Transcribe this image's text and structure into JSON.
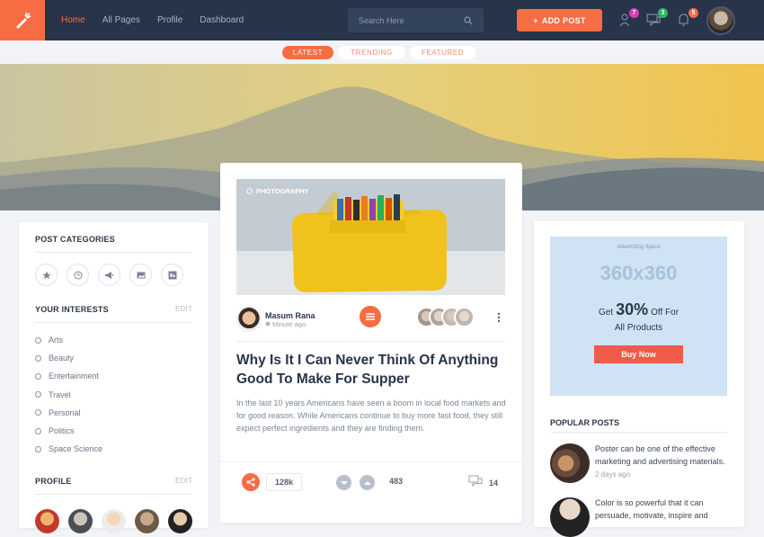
{
  "nav": {
    "items": [
      {
        "label": "Home",
        "active": true
      },
      {
        "label": "All Pages",
        "active": false
      },
      {
        "label": "Profile",
        "active": false
      },
      {
        "label": "Dashboard",
        "active": false
      }
    ],
    "search_placeholder": "Search Here",
    "add_post_label": "ADD POST",
    "notifications": [
      {
        "icon": "user-icon",
        "count": "7",
        "color": "#d63cb8"
      },
      {
        "icon": "chat-icon",
        "count": "3",
        "color": "#2ab566"
      },
      {
        "icon": "bell-icon",
        "count": "5",
        "color": "#f76c42"
      }
    ]
  },
  "tabs": [
    "LATEST",
    "TRENDING",
    "FEATURED"
  ],
  "sidebar": {
    "categories_title": "POST CATEGORIES",
    "category_icons": [
      "star-icon",
      "clock-icon",
      "megaphone-icon",
      "image-icon",
      "gallery-icon"
    ],
    "interests_title": "YOUR INTERESTS",
    "edit_label": "EDIT",
    "interests": [
      "Arts",
      "Beauty",
      "Entertainment",
      "Travel",
      "Personal",
      "Politics",
      "Space Science"
    ],
    "profile_title": "PROFILE"
  },
  "post": {
    "tag": "PHOTOGRAPHY",
    "author": "Masum Rana",
    "time": "Minute ago",
    "title": "Why Is It I Can Never Think Of Anything Good To Make For Supper",
    "excerpt": "In the last 10 years Americans have seen a boom in local food markets and for good reason. While Americans continue to buy more fast food, they still expect perfect ingredients and they are finding them.",
    "shares": "128k",
    "votes": "483",
    "comments": "14"
  },
  "ad": {
    "label": "Advertizing Space",
    "size": "360x360",
    "get": "Get",
    "percent": "30%",
    "off_for": "Off For",
    "all_products": "All Products",
    "button": "Buy Now"
  },
  "popular": {
    "title": "POPULAR POSTS",
    "items": [
      {
        "text": "Poster can be one of the effective marketing and advertising materials.",
        "time": "2 days ago"
      },
      {
        "text": "Color is so powerful that it can persuade, motivate, inspire and",
        "time": ""
      }
    ]
  },
  "colors": {
    "accent": "#f76c42",
    "nav_bg": "#27344a"
  }
}
